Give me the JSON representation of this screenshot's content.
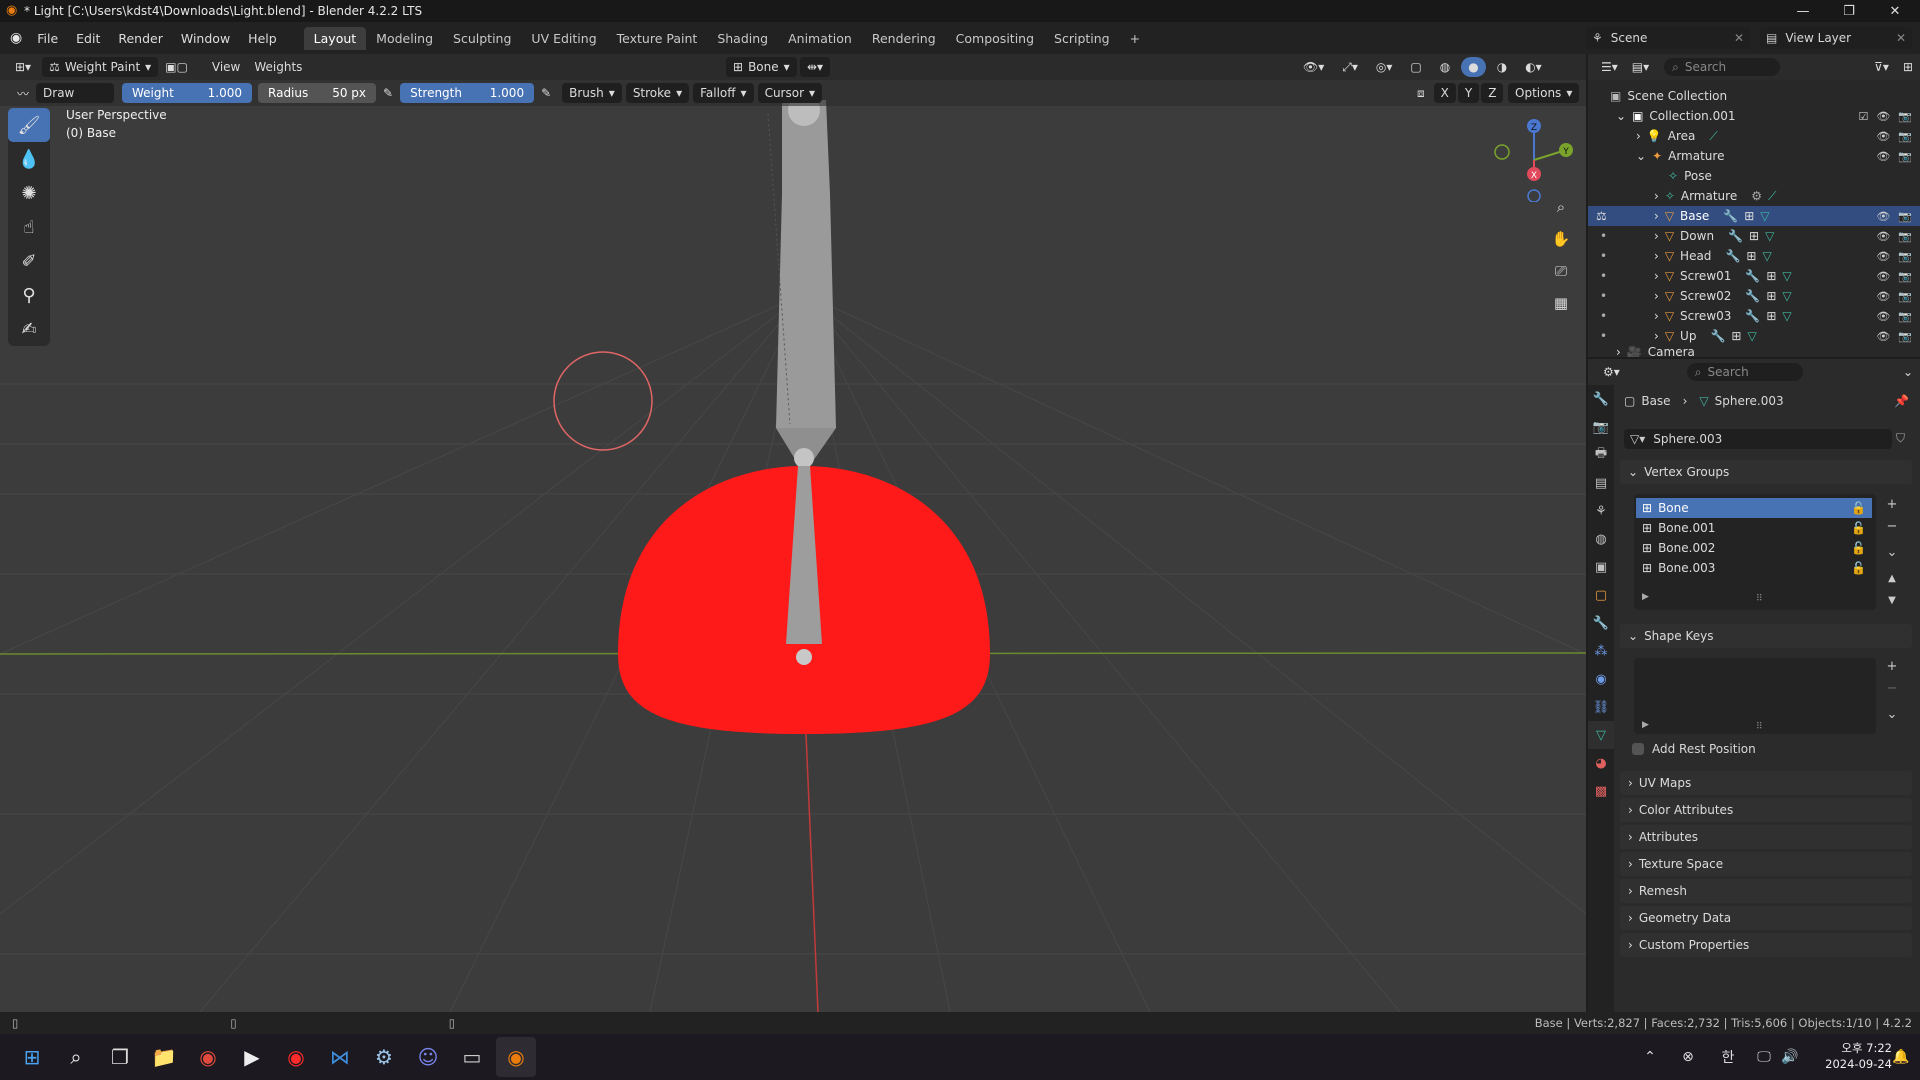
{
  "window": {
    "title": "* Light [C:\\Users\\kdst4\\Downloads\\Light.blend] - Blender 4.2.2 LTS",
    "controls": {
      "minimize": "—",
      "maximize": "❐",
      "close": "✕"
    }
  },
  "menu": {
    "items": [
      "File",
      "Edit",
      "Render",
      "Window",
      "Help"
    ],
    "workspaces": [
      "Layout",
      "Modeling",
      "Sculpting",
      "UV Editing",
      "Texture Paint",
      "Shading",
      "Animation",
      "Rendering",
      "Compositing",
      "Scripting"
    ],
    "active_workspace": "Layout",
    "add_workspace": "+",
    "scene": "Scene",
    "view_layer": "View Layer"
  },
  "viewport_header": {
    "mode": "Weight Paint",
    "view": "View",
    "weights": "Weights",
    "bone_dropdown": "Bone"
  },
  "tool_header": {
    "brush_name": "Draw",
    "weight_label": "Weight",
    "weight_value": "1.000",
    "radius_label": "Radius",
    "radius_value": "50 px",
    "strength_label": "Strength",
    "strength_value": "1.000",
    "brush": "Brush",
    "stroke": "Stroke",
    "falloff": "Falloff",
    "cursor": "Cursor",
    "axes": [
      "X",
      "Y",
      "Z"
    ],
    "options": "Options"
  },
  "viewport": {
    "perspective": "User Perspective",
    "object_label": "(0) Base",
    "gizmo": {
      "z": "Z",
      "y": "Y",
      "x": "X"
    }
  },
  "outliner": {
    "search_placeholder": "Search",
    "scene_collection": "Scene Collection",
    "rows": [
      {
        "label": "Collection.001"
      },
      {
        "label": "Area"
      },
      {
        "label": "Armature"
      },
      {
        "label": "Pose"
      },
      {
        "label": "Armature"
      },
      {
        "label": "Base"
      },
      {
        "label": "Down"
      },
      {
        "label": "Head"
      },
      {
        "label": "Screw01"
      },
      {
        "label": "Screw02"
      },
      {
        "label": "Screw03"
      },
      {
        "label": "Up"
      },
      {
        "label": "Camera"
      }
    ]
  },
  "properties": {
    "search_placeholder": "Search",
    "breadcrumb_object": "Base",
    "breadcrumb_data": "Sphere.003",
    "mesh_name": "Sphere.003",
    "vertex_groups_title": "Vertex Groups",
    "vertex_groups": [
      "Bone",
      "Bone.001",
      "Bone.002",
      "Bone.003"
    ],
    "shape_keys_title": "Shape Keys",
    "add_rest_position": "Add Rest Position",
    "sections": [
      "UV Maps",
      "Color Attributes",
      "Attributes",
      "Texture Space",
      "Remesh",
      "Geometry Data",
      "Custom Properties"
    ]
  },
  "statusbar": {
    "info": "Base | Verts:2,827 | Faces:2,732 | Tris:5,606 | Objects:1/10 | 4.2.2"
  },
  "taskbar": {
    "time": "오후 7:22",
    "date": "2024-09-24",
    "ime": "한"
  },
  "colors": {
    "accent": "#4772b3",
    "mesh_red": "#ff1a1a",
    "selected_row": "#334d80"
  }
}
